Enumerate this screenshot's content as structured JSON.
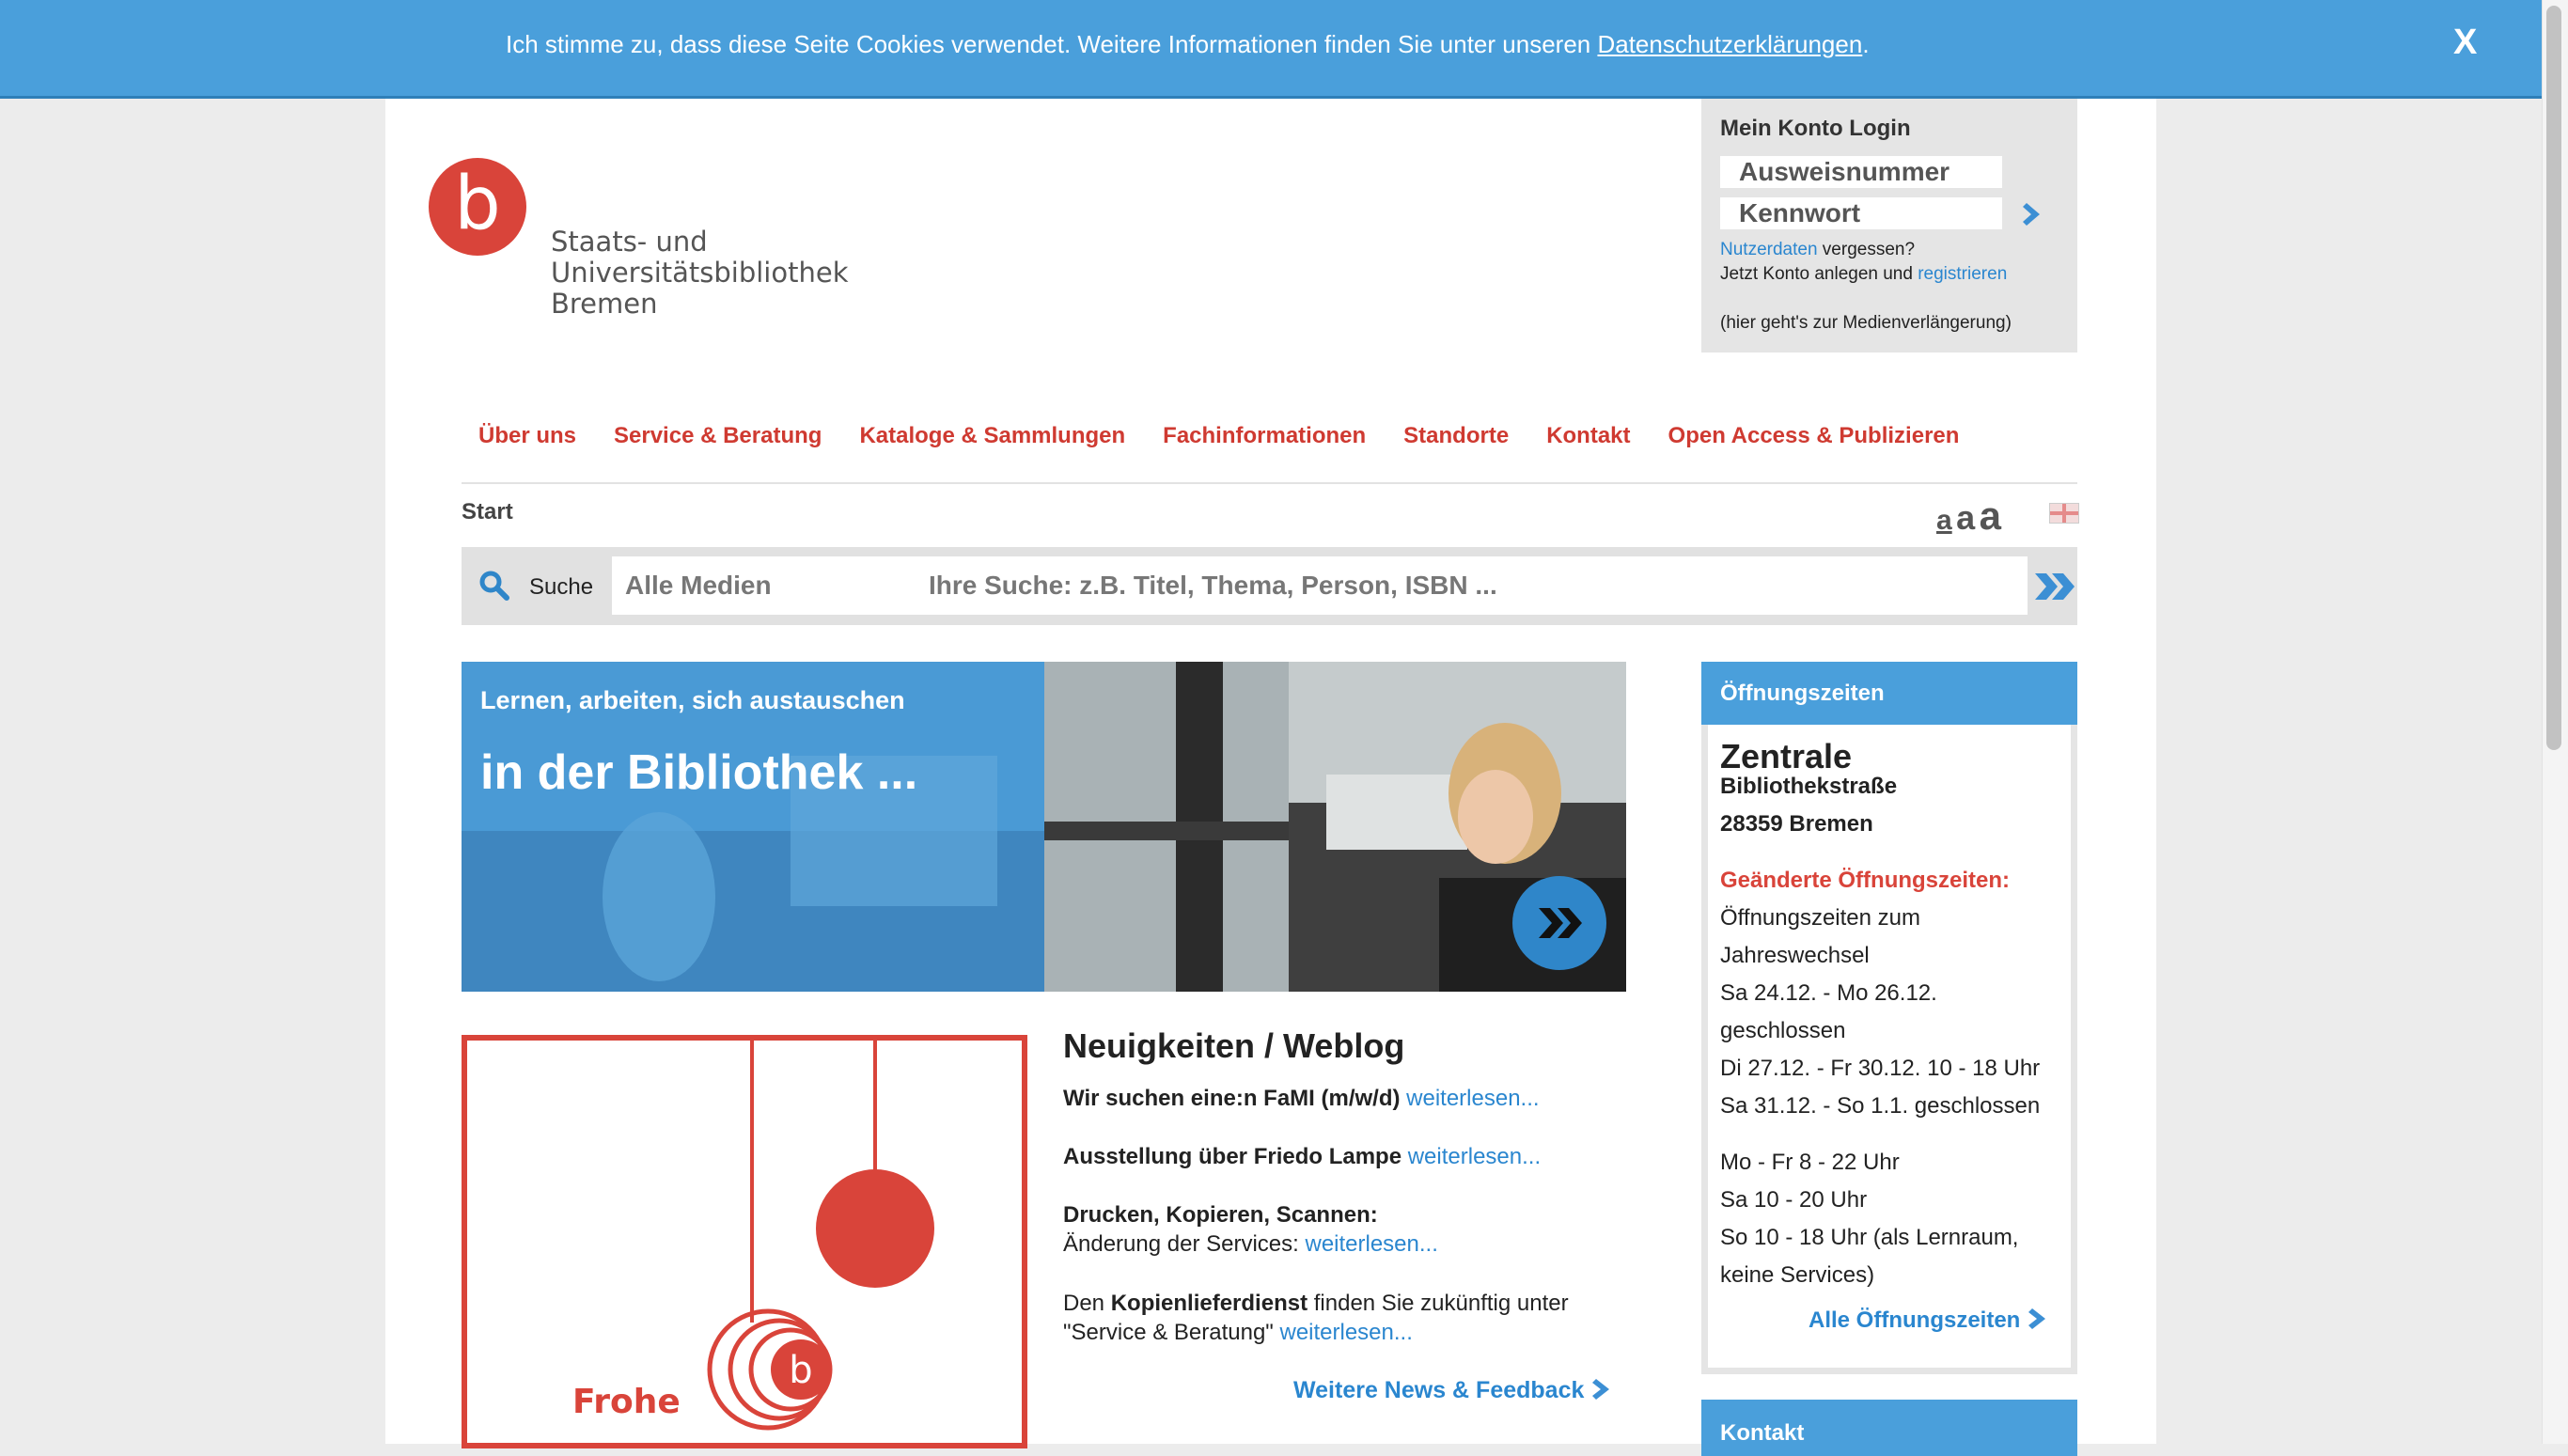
{
  "cookie_bar": {
    "text": "Ich stimme zu, dass diese Seite Cookies verwendet. Weitere Informationen finden Sie unter unseren ",
    "link": "Datenschutzerklärungen",
    "suffix": ".",
    "close": "X"
  },
  "logo": {
    "letter": "b",
    "line1": "Staats- und",
    "line2": "Universitätsbibliothek",
    "line3": "Bremen"
  },
  "login": {
    "title": "Mein Konto Login",
    "id_placeholder": "Ausweisnummer",
    "pw_placeholder": "Kennwort",
    "forgot_link": "Nutzerdaten",
    "forgot_rest": " vergessen?",
    "create_text": "Jetzt Konto anlegen und ",
    "register_link": "registrieren",
    "renewal": "(hier geht's zur Medienverlängerung)"
  },
  "nav": [
    "Über uns",
    "Service & Beratung",
    "Kataloge & Sammlungen",
    "Fachinformationen",
    "Standorte",
    "Kontakt",
    "Open Access & Publizieren"
  ],
  "breadcrumb": "Start",
  "font_sizes": [
    "a",
    "a",
    "a"
  ],
  "search": {
    "label": "Suche",
    "select_value": "Alle Medien",
    "placeholder": "Ihre Suche: z.B. Titel, Thema, Person, ISBN ..."
  },
  "hero": {
    "subtitle": "Lernen, arbeiten, sich austauschen",
    "title": "in der Bibliothek ..."
  },
  "card": {
    "text": "Frohe"
  },
  "news": {
    "title": "Neuigkeiten / Weblog",
    "item1_bold": "Wir suchen eine:n FaMI (m/w/d)",
    "item1_link": "weiterlesen...",
    "item2_bold": "Ausstellung über Friedo Lampe",
    "item2_link": "weiterlesen...",
    "item3_bold": "Drucken, Kopieren, Scannen:",
    "item3_text": "Änderung der Services: ",
    "item3_link": "weiterlesen...",
    "item4_pre": "Den ",
    "item4_bold": "Kopienlieferdienst",
    "item4_text": " finden Sie zukünftig unter",
    "item4_line2": "\"Service & Beratung\" ",
    "item4_link": "weiterlesen...",
    "more": "Weitere News & Feedback"
  },
  "hours": {
    "header": "Öffnungszeiten",
    "location": "Zentrale",
    "street": "Bibliothekstraße",
    "city": "28359 Bremen",
    "changed_label": "Geänderte Öffnungszeiten:",
    "changed_lines": [
      "Öffnungszeiten zum",
      "Jahreswechsel",
      "Sa 24.12. - Mo 26.12.",
      "geschlossen",
      "Di 27.12. - Fr 30.12. 10 - 18 Uhr",
      "Sa 31.12. - So 1.1. geschlossen"
    ],
    "regular_lines": [
      "Mo - Fr 8 - 22 Uhr",
      "Sa 10 - 20 Uhr",
      "So 10 - 18 Uhr (als Lernraum,",
      "keine Services)"
    ],
    "all_link": "Alle Öffnungszeiten"
  },
  "contact": {
    "header": "Kontakt"
  },
  "colors": {
    "accent_blue": "#4a9fdb",
    "brand_red": "#d9443a",
    "link_blue": "#2a86cf"
  }
}
